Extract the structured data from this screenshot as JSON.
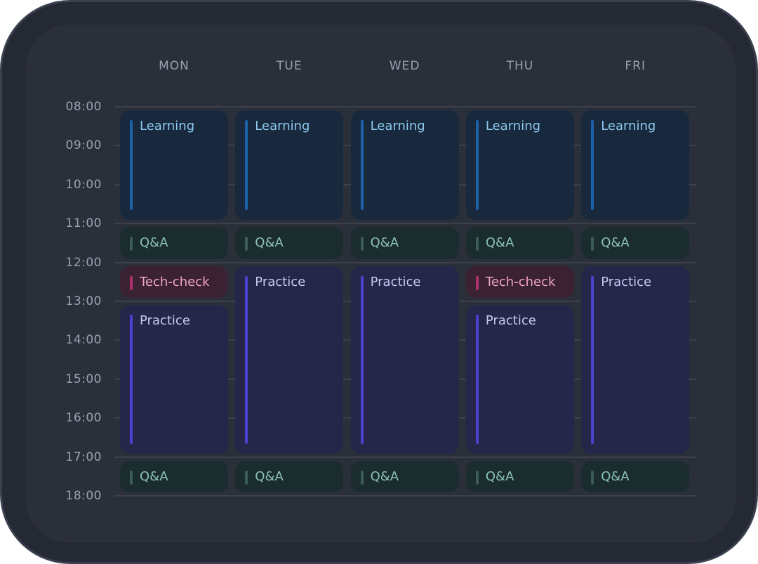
{
  "days": [
    "MON",
    "TUE",
    "WED",
    "THU",
    "FRI"
  ],
  "times": [
    "08:00",
    "09:00",
    "10:00",
    "11:00",
    "12:00",
    "13:00",
    "14:00",
    "15:00",
    "16:00",
    "17:00",
    "18:00"
  ],
  "event_types": {
    "learning": {
      "label": "Learning",
      "color": "#1c62a8"
    },
    "qa": {
      "label": "Q&A",
      "color": "#3c5b5c"
    },
    "tech": {
      "label": "Tech-check",
      "color": "#b0306e"
    },
    "practice": {
      "label": "Practice",
      "color": "#4a43d2"
    }
  },
  "events": [
    {
      "day": "MON",
      "type": "learning",
      "title": "Learning",
      "start": "08:00",
      "end": "11:00"
    },
    {
      "day": "MON",
      "type": "qa",
      "title": "Q&A",
      "start": "11:00",
      "end": "12:00"
    },
    {
      "day": "MON",
      "type": "tech",
      "title": "Tech-check",
      "start": "12:00",
      "end": "13:00"
    },
    {
      "day": "MON",
      "type": "practice",
      "title": "Practice",
      "start": "13:00",
      "end": "17:00"
    },
    {
      "day": "MON",
      "type": "qa",
      "title": "Q&A",
      "start": "17:00",
      "end": "18:00"
    },
    {
      "day": "TUE",
      "type": "learning",
      "title": "Learning",
      "start": "08:00",
      "end": "11:00"
    },
    {
      "day": "TUE",
      "type": "qa",
      "title": "Q&A",
      "start": "11:00",
      "end": "12:00"
    },
    {
      "day": "TUE",
      "type": "practice",
      "title": "Practice",
      "start": "12:00",
      "end": "17:00"
    },
    {
      "day": "TUE",
      "type": "qa",
      "title": "Q&A",
      "start": "17:00",
      "end": "18:00"
    },
    {
      "day": "WED",
      "type": "learning",
      "title": "Learning",
      "start": "08:00",
      "end": "11:00"
    },
    {
      "day": "WED",
      "type": "qa",
      "title": "Q&A",
      "start": "11:00",
      "end": "12:00"
    },
    {
      "day": "WED",
      "type": "practice",
      "title": "Practice",
      "start": "12:00",
      "end": "17:00"
    },
    {
      "day": "WED",
      "type": "qa",
      "title": "Q&A",
      "start": "17:00",
      "end": "18:00"
    },
    {
      "day": "THU",
      "type": "learning",
      "title": "Learning",
      "start": "08:00",
      "end": "11:00"
    },
    {
      "day": "THU",
      "type": "qa",
      "title": "Q&A",
      "start": "11:00",
      "end": "12:00"
    },
    {
      "day": "THU",
      "type": "tech",
      "title": "Tech-check",
      "start": "12:00",
      "end": "13:00"
    },
    {
      "day": "THU",
      "type": "practice",
      "title": "Practice",
      "start": "13:00",
      "end": "17:00"
    },
    {
      "day": "THU",
      "type": "qa",
      "title": "Q&A",
      "start": "17:00",
      "end": "18:00"
    },
    {
      "day": "FRI",
      "type": "learning",
      "title": "Learning",
      "start": "08:00",
      "end": "11:00"
    },
    {
      "day": "FRI",
      "type": "qa",
      "title": "Q&A",
      "start": "11:00",
      "end": "12:00"
    },
    {
      "day": "FRI",
      "type": "practice",
      "title": "Practice",
      "start": "12:00",
      "end": "17:00"
    },
    {
      "day": "FRI",
      "type": "qa",
      "title": "Q&A",
      "start": "17:00",
      "end": "18:00"
    }
  ]
}
